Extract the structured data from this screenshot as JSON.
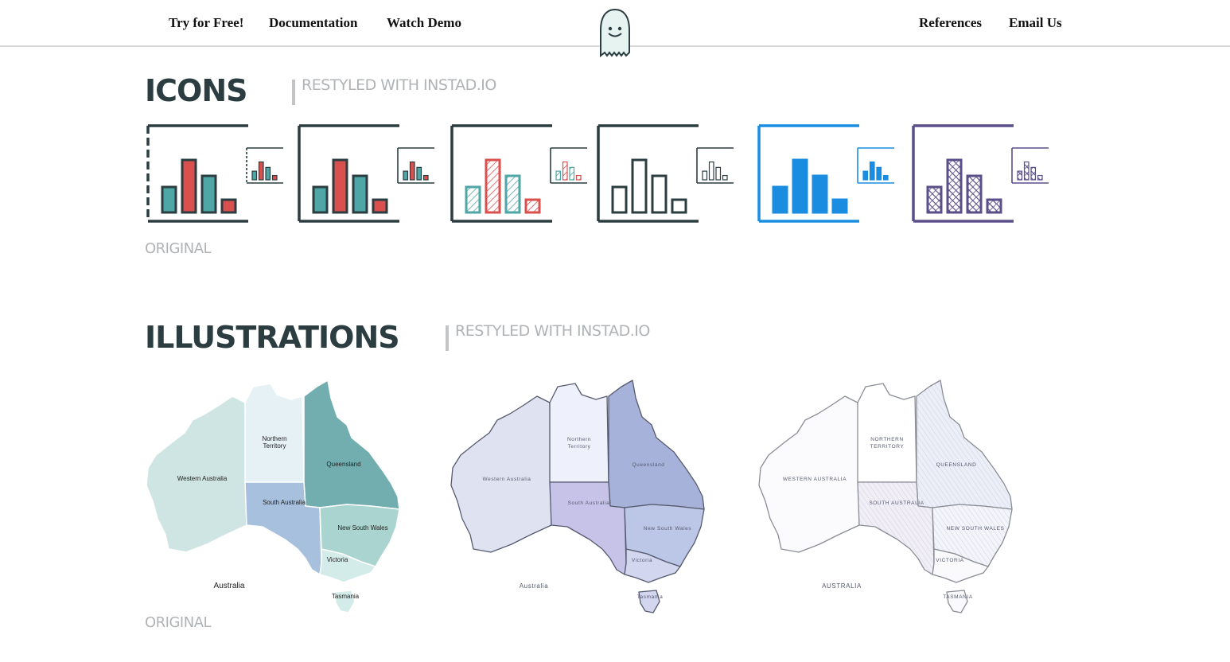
{
  "nav": {
    "try_free": "Try for Free!",
    "documentation": "Documentation",
    "watch_demo": "Watch Demo",
    "references": "References",
    "email_us": "Email Us"
  },
  "icons_section": {
    "title": "ICONS",
    "subtitle": "RESTYLED WITH INSTAD.IO",
    "caption": "ORIGINAL",
    "variants": [
      {
        "style": "original",
        "frame": "#2b3d40",
        "fills": [
          "#4fa6a6",
          "#d9504f",
          "#4fa6a6",
          "#d9504f"
        ]
      },
      {
        "style": "solid",
        "frame": "#2b3d40",
        "fills": [
          "#4fa6a6",
          "#d9504f",
          "#4fa6a6",
          "#d9504f"
        ]
      },
      {
        "style": "hatched",
        "frame": "#2b3d40",
        "fills": [
          "#4fa6a6",
          "#d9504f",
          "#4fa6a6",
          "#d9504f"
        ]
      },
      {
        "style": "outline",
        "frame": "#2b3d40",
        "fills": [
          "none",
          "none",
          "none",
          "none"
        ]
      },
      {
        "style": "blue",
        "frame": "#1a8de0",
        "fills": [
          "#1a8de0",
          "#1a8de0",
          "#1a8de0",
          "#1a8de0"
        ]
      },
      {
        "style": "crosshatch",
        "frame": "#5b4f8a",
        "fills": [
          "#5b4f8a",
          "#5b4f8a",
          "#5b4f8a",
          "#5b4f8a"
        ]
      }
    ]
  },
  "illustrations_section": {
    "title": "ILLUSTRATIONS",
    "subtitle": "RESTYLED WITH INSTAD.IO",
    "caption": "ORIGINAL"
  },
  "maps": [
    {
      "style": "original",
      "country": "Australia",
      "states": {
        "wa": "Western Australia",
        "nt": "Northern Territory",
        "qld": "Queensland",
        "sa": "South Australia",
        "nsw": "New South Wales",
        "vic": "Victoria",
        "tas": "Tasmania"
      },
      "colors": {
        "wa": "#cfe5e3",
        "nt": "#e6f1f6",
        "qld": "#72aeb0",
        "sa": "#a6c0de",
        "nsw": "#a9d4cf",
        "vic": "#d3ecea",
        "tas": "#d3ecea",
        "stroke": "#ffffff"
      }
    },
    {
      "style": "sketch",
      "country": "Australia",
      "states": {
        "wa": "Western Australia",
        "nt": "Northern Territory",
        "qld": "Queensland",
        "sa": "South Australia",
        "nsw": "New South Wales",
        "vic": "Victoria",
        "tas": "Tasmania"
      },
      "colors": {
        "wa": "#dfe3f1",
        "nt": "#eef0fb",
        "qld": "#a7b2da",
        "sa": "#c6c2e8",
        "nsw": "#bcc6e6",
        "vic": "#d2d6ee",
        "tas": "#d2d6ee",
        "stroke": "#555a6e"
      }
    },
    {
      "style": "pencil",
      "country": "AUSTRALIA",
      "states": {
        "wa": "WESTERN AUSTRALIA",
        "nt": "NORTHERN TERRITORY",
        "qld": "QUEENSLAND",
        "sa": "SOUTH AUSTRALIA",
        "nsw": "NEW SOUTH WALES",
        "vic": "VICTORIA",
        "tas": "TASMANIA"
      },
      "colors": {
        "wa": "#fbfbfe",
        "nt": "#ffffff",
        "qld": "#eceff8",
        "sa": "#f1eef6",
        "nsw": "#f4f5fa",
        "vic": "#fafafd",
        "tas": "#fafafd",
        "stroke": "#8a8d96"
      }
    }
  ]
}
